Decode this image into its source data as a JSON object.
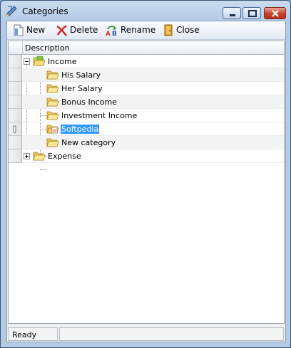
{
  "window": {
    "title": "Categories"
  },
  "toolbar": {
    "new_label": "New",
    "delete_label": "Delete",
    "rename_label": "Rename",
    "close_label": "Close"
  },
  "grid": {
    "column_header": "Description",
    "rows": [
      {
        "label": "Income",
        "level": 0,
        "expanded": true,
        "icon": "folder-open-icon"
      },
      {
        "label": "His Salary",
        "level": 1,
        "icon": "folder-icon"
      },
      {
        "label": "Her Salary",
        "level": 1,
        "icon": "folder-icon"
      },
      {
        "label": "Bonus Income",
        "level": 1,
        "icon": "folder-icon"
      },
      {
        "label": "Investment Income",
        "level": 1,
        "icon": "folder-icon"
      },
      {
        "label": "Softpedia",
        "level": 1,
        "icon": "folder-edit-icon",
        "selected": true,
        "editing": true
      },
      {
        "label": "New category",
        "level": 1,
        "icon": "folder-icon"
      },
      {
        "label": "Expense",
        "level": 0,
        "expanded": false,
        "icon": "folder-icon"
      }
    ]
  },
  "statusbar": {
    "text": "Ready"
  },
  "colors": {
    "selection": "#3399ff",
    "titlebar": "#b4cbe6",
    "close_button": "#c8432d"
  }
}
